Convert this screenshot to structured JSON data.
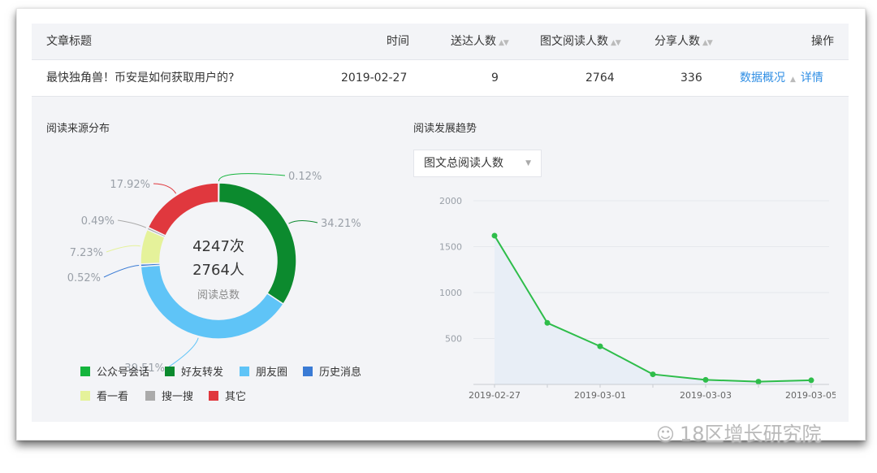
{
  "table": {
    "headers": {
      "title": "文章标题",
      "time": "时间",
      "delivered": "送达人数",
      "reads": "图文阅读人数",
      "shares": "分享人数",
      "action": "操作"
    },
    "row": {
      "title": "最快独角兽！币安是如何获取用户的?",
      "time": "2019-02-27",
      "delivered": "9",
      "reads": "2764",
      "shares": "336",
      "overview_link": "数据概况",
      "detail_link": "详情"
    }
  },
  "source_panel": {
    "title": "阅读来源分布",
    "center_total_times": "4247次",
    "center_total_people": "2764人",
    "center_caption": "阅读总数"
  },
  "trend_panel": {
    "title": "阅读发展趋势",
    "metric_select": "图文总阅读人数"
  },
  "watermark": "18区增长研究院",
  "chart_data": [
    {
      "type": "pie",
      "donut": true,
      "categories": [
        "公众号会话",
        "好友转发",
        "朋友圈",
        "历史消息",
        "看一看",
        "搜一搜",
        "其它"
      ],
      "values": [
        0.12,
        34.21,
        39.51,
        0.52,
        7.23,
        0.49,
        17.92
      ],
      "labels": [
        "0.12%",
        "34.21%",
        "39.51%",
        "0.52%",
        "7.23%",
        "0.49%",
        "17.92%"
      ],
      "colors": [
        "#14b43c",
        "#0c8a2e",
        "#5fc4f7",
        "#3a7bd5",
        "#e5f29a",
        "#aaaaaa",
        "#e0383e"
      ],
      "legend_position": "bottom"
    },
    {
      "type": "area",
      "x": [
        "2019-02-27",
        "2019-02-28",
        "2019-03-01",
        "2019-03-02",
        "2019-03-03",
        "2019-03-04",
        "2019-03-05"
      ],
      "y": [
        1620,
        670,
        415,
        110,
        50,
        30,
        45
      ],
      "x_tick_labels": [
        "2019-02-27",
        "2019-03-01",
        "2019-03-03",
        "2019-03-05"
      ],
      "y_ticks": [
        500,
        1000,
        1500,
        2000
      ],
      "ylim": [
        0,
        2000
      ],
      "grid": true,
      "line_color": "#2ebd4a",
      "fill_color": "#e8eef6"
    }
  ]
}
